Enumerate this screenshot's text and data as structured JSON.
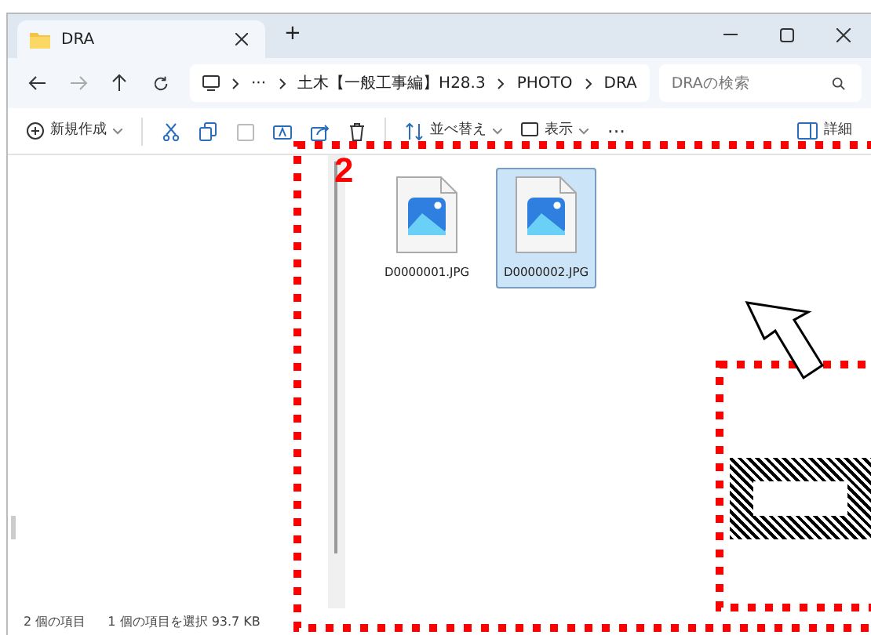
{
  "window": {
    "tabs": [
      {
        "title": "DRA",
        "selected": true
      }
    ],
    "new_tab": "+"
  },
  "address_bar": {
    "more": "···",
    "breadcrumb": [
      "土木【一般工事編】H28.3",
      "PHOTO",
      "DRA"
    ],
    "search": {
      "placeholder": "DRAの検索"
    }
  },
  "toolbar": {
    "new": "新規作成",
    "sort": "並べ替え",
    "view": "表示",
    "more": "···",
    "details": "詳細"
  },
  "files": [
    {
      "name": "D0000001.JPG",
      "selected": false
    },
    {
      "name": "D0000002.JPG",
      "selected": true
    }
  ],
  "status_bar": {
    "count": "2 個の項目",
    "selection": "1 個の項目を選択",
    "size": "93.7 KB"
  },
  "annotation": {
    "number": "2"
  }
}
